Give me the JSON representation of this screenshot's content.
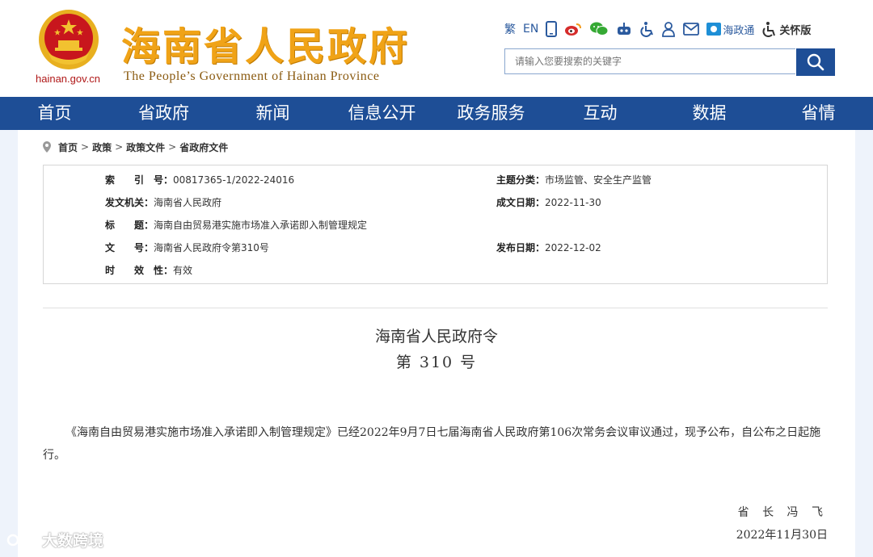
{
  "header": {
    "domain": "hainan.gov.cn",
    "title": "海南省人民政府",
    "subtitle": "The People’s Government  of Hainan Province",
    "toolbar": {
      "traditional": "繁",
      "english": "EN",
      "hainan_app": "海政通",
      "care_mode": "关怀版"
    },
    "search": {
      "placeholder": "请输入您要搜索的关键字"
    }
  },
  "nav": [
    "首页",
    "省政府",
    "新闻",
    "信息公开",
    "政务服务",
    "互动",
    "数据",
    "省情"
  ],
  "breadcrumb": [
    "首页",
    "政策",
    "政策文件",
    "省政府文件"
  ],
  "meta": {
    "index_label": "索　　引　号：",
    "index": "00817365-1/2022-24016",
    "topic_label": "主题分类：",
    "topic": "市场监管、安全生产监管",
    "issuer_label": "发文机关：",
    "issuer": "海南省人民政府",
    "created_label": "成文日期：",
    "created": "2022-11-30",
    "title_label": "标　　题：",
    "title": "海南自由贸易港实施市场准入承诺即入制管理规定",
    "docno_label": "文　　号：",
    "docno": "海南省人民政府令第310号",
    "published_label": "发布日期：",
    "published": "2022-12-02",
    "validity_label": "时　　效　性：",
    "validity": "有效"
  },
  "document": {
    "heading": "海南省人民政府令",
    "number": "第 310 号",
    "body": "《海南自由贸易港实施市场准入承诺即入制管理规定》已经2022年9月7日七届海南省人民政府第106次常务会议审议通过，现予公布，自公布之日起施行。",
    "signer": "省 长 冯 飞",
    "date": "2022年11月30日"
  },
  "watermark": "大数跨境",
  "colors": {
    "brand_blue": "#1e4e96",
    "title_gold": "#f0a317",
    "emblem_red": "#c8161d"
  }
}
